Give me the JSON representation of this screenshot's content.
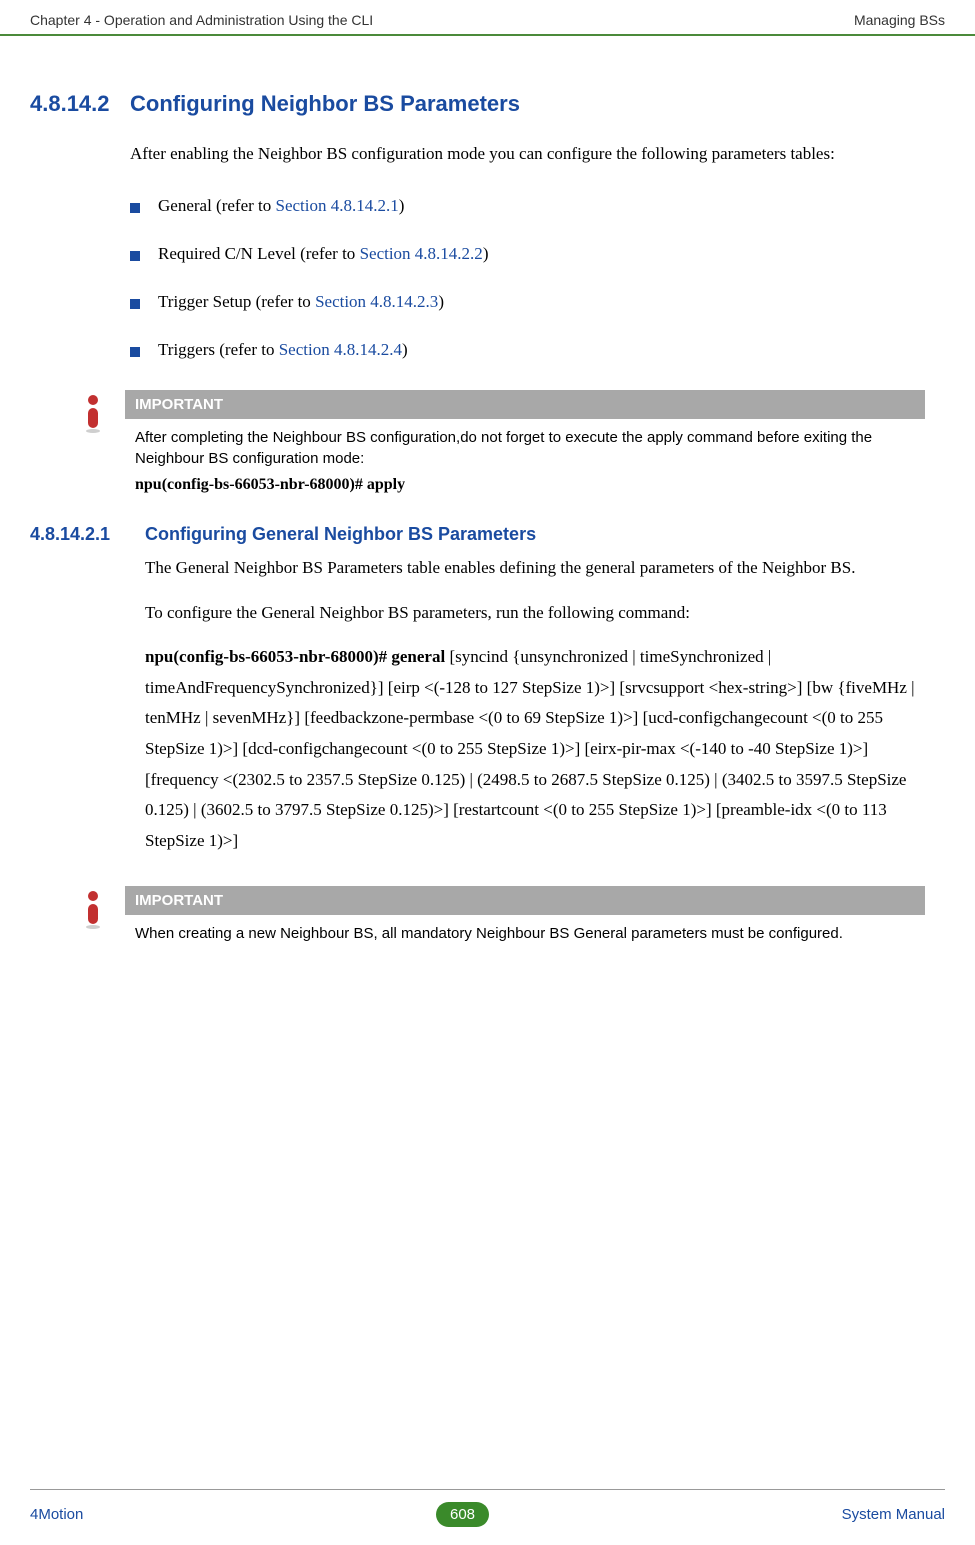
{
  "header": {
    "left": "Chapter 4 - Operation and Administration Using the CLI",
    "right": "Managing BSs"
  },
  "section": {
    "num": "4.8.14.2",
    "title": "Configuring Neighbor BS Parameters",
    "intro": "After enabling the Neighbor BS configuration mode you can configure the following parameters tables:"
  },
  "bullets": [
    {
      "prefix": "General (refer to ",
      "link": "Section 4.8.14.2.1",
      "suffix": ")"
    },
    {
      "prefix": "Required C/N Level (refer to ",
      "link": "Section 4.8.14.2.2",
      "suffix": ")"
    },
    {
      "prefix": "Trigger Setup (refer to ",
      "link": "Section 4.8.14.2.3",
      "suffix": ")"
    },
    {
      "prefix": "Triggers (refer to ",
      "link": "Section 4.8.14.2.4",
      "suffix": ")"
    }
  ],
  "important1": {
    "label": "IMPORTANT",
    "body": "After completing the Neighbour BS configuration,do not forget to execute the apply command before exiting the Neighbour BS configuration mode:",
    "command": "npu(config-bs-66053-nbr-68000)# apply"
  },
  "subsection": {
    "num": "4.8.14.2.1",
    "title": "Configuring General Neighbor BS Parameters",
    "p1": "The General Neighbor BS Parameters table enables defining the general parameters of the Neighbor BS.",
    "p2": "To configure the General Neighbor BS parameters, run the following command:",
    "cmdBold": "npu(config-bs-66053-nbr-68000)# general",
    "cmdRest": " [syncind {unsynchronized | timeSynchronized | timeAndFrequencySynchronized}] [eirp <(-128 to 127 StepSize 1)>] [srvcsupport <hex-string>] [bw {fiveMHz | tenMHz | sevenMHz}] [feedbackzone-permbase <(0 to 69 StepSize 1)>] [ucd-configchangecount <(0 to 255 StepSize 1)>] [dcd-configchangecount <(0 to 255 StepSize 1)>] [eirx-pir-max <(-140 to -40 StepSize 1)>] [frequency <(2302.5 to 2357.5 StepSize 0.125) | (2498.5 to 2687.5 StepSize 0.125) | (3402.5 to 3597.5 StepSize 0.125) | (3602.5 to 3797.5 StepSize 0.125)>] [restartcount <(0 to 255 StepSize 1)>] [preamble-idx <(0 to 113 StepSize 1)>]"
  },
  "important2": {
    "label": "IMPORTANT",
    "body": "When creating a new Neighbour BS, all mandatory Neighbour BS General parameters must be configured."
  },
  "footer": {
    "left": "4Motion",
    "page": "608",
    "right": "System Manual"
  }
}
